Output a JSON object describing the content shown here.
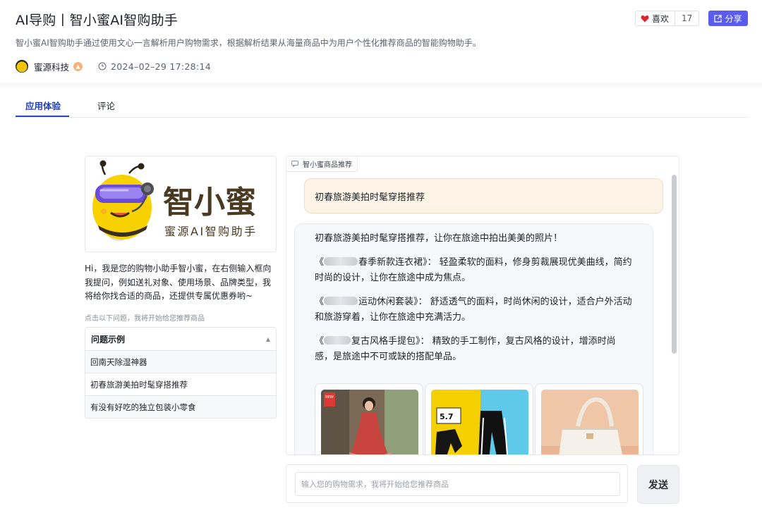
{
  "header": {
    "title": "AI导购丨智小蜜AI智购助手",
    "subtitle": "智小蜜AI智购助手通过使用文心一言解析用户购物需求，根据解析结果从海量商品中为用户个性化推荐商品的智能购物助手。",
    "author": "蜜源科技",
    "date": "2024–02–29 17:28:14",
    "like_label": "喜欢",
    "like_count": "17",
    "share_label": "分享"
  },
  "tabs": [
    {
      "label": "应用体验",
      "active": true
    },
    {
      "label": "评论",
      "active": false
    }
  ],
  "left_panel": {
    "logo_title": "智小蜜",
    "logo_sub": "蜜源AI智购助手",
    "intro": "Hi，我是您的购物小助手智小蜜，在右侧输入框向我提问，例如送礼对象、使用场景、品牌类型，我将给你找合适的商品，还提供专属优惠券哟~",
    "hint": "点击以下问题，我将开始给您推荐商品",
    "questions_header": "问题示例",
    "questions": [
      "回南天除湿神器",
      "初春旅游美拍时髦穿搭推荐",
      "有没有好吃的独立包装小零食"
    ]
  },
  "chat": {
    "tag": "智小蜜商品推荐",
    "user_message": "初春旅游美拍时髦穿搭推荐",
    "bot_intro": "初春旅游美拍时髦穿搭推荐，让你在旅途中拍出美美的照片！",
    "items": [
      {
        "open": "《",
        "name": "春季新款连衣裙》：",
        "desc": "轻盈柔软的面料，修身剪裁展现优美曲线，简约时尚的设计，让你在旅途中成为焦点。"
      },
      {
        "open": "《",
        "name": "运动休闲套装》：",
        "desc": "舒适透气的面料，时尚休闲的设计，适合户外活动和旅游穿着，让你在旅途中充满活力。"
      },
      {
        "open": "《",
        "name": "复古风格手提包》：",
        "desc": "精致的手工制作，复古风格的设计，增添时尚感，是旅途中不可或缺的搭配单品。"
      }
    ],
    "products": [
      {
        "name": "dress-product",
        "badge": "NEW 新款上市"
      },
      {
        "name": "tracksuit-product",
        "badge": "5.7折"
      },
      {
        "name": "handbag-product",
        "badge": ""
      }
    ]
  },
  "input": {
    "placeholder": "输入您的购物需求，我将开始给您推荐商品",
    "send_label": "发送"
  },
  "colors": {
    "accent": "#5b5bf0",
    "tab_active": "#1d3fbf",
    "user_bubble": "#fdf3e6",
    "bot_bubble": "#f6f8fb"
  }
}
